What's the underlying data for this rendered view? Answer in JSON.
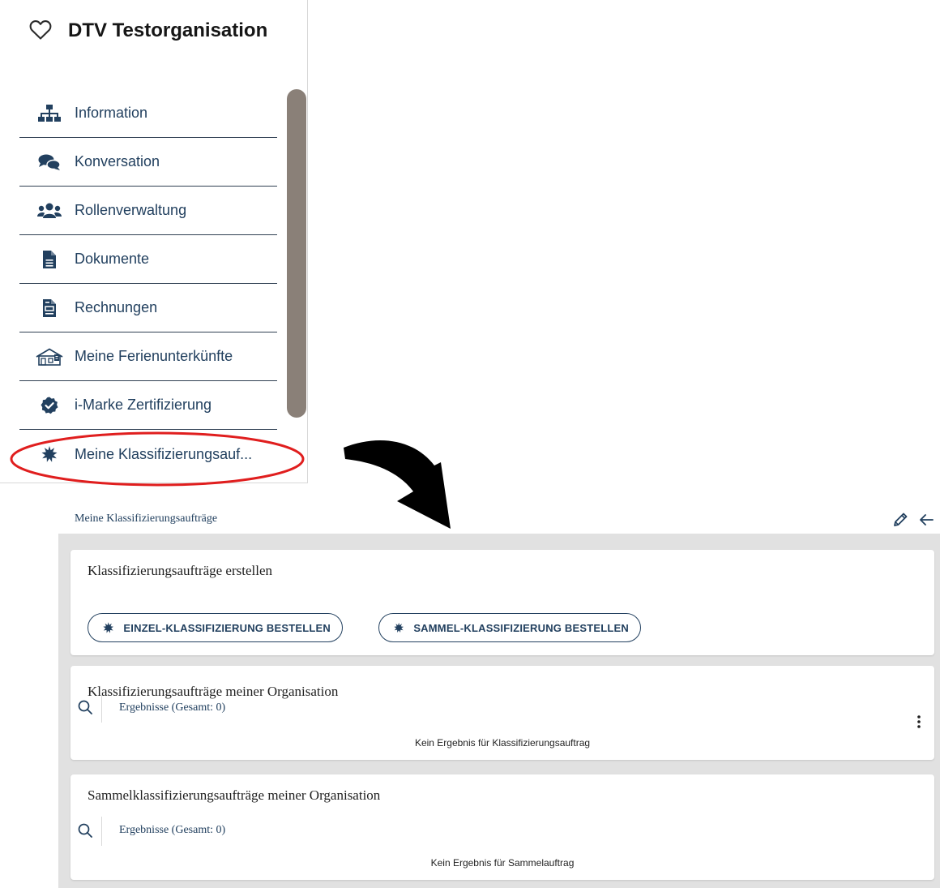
{
  "sidebar": {
    "org_title": "DTV Testorganisation",
    "items": [
      {
        "label": "Information",
        "icon": "sitemap-icon"
      },
      {
        "label": "Konversation",
        "icon": "comments-icon"
      },
      {
        "label": "Rollenverwaltung",
        "icon": "users-icon"
      },
      {
        "label": "Dokumente",
        "icon": "file-icon"
      },
      {
        "label": "Rechnungen",
        "icon": "invoice-icon"
      },
      {
        "label": "Meine Ferienunterkünfte",
        "icon": "house-icon"
      },
      {
        "label": "i-Marke Zertifizierung",
        "icon": "certificate-badge-icon"
      },
      {
        "label": "Meine Klassifizierungsauf...",
        "icon": "star-burst-icon"
      }
    ]
  },
  "main": {
    "page_title": "Meine Klassifizierungsaufträge",
    "create_card": {
      "title": "Klassifizierungsaufträge erstellen",
      "btn_single": "EINZEL-KLASSIFIZIERUNG BESTELLEN",
      "btn_bulk": "SAMMEL-KLASSIFIZIERUNG BESTELLEN"
    },
    "orders_card": {
      "title": "Klassifizierungsaufträge meiner Organisation",
      "results": "Ergebnisse (Gesamt: 0)",
      "empty": "Kein Ergebnis für Klassifizierungsauftrag"
    },
    "bulk_card": {
      "title": "Sammelklassifizierungsaufträge meiner Organisation",
      "results": "Ergebnisse (Gesamt: 0)",
      "empty": "Kein Ergebnis für Sammelauftrag"
    }
  },
  "colors": {
    "primary": "#22405f",
    "highlight": "#e01e1e",
    "scrollbar": "#8a8078",
    "background": "#e1e1e1"
  }
}
